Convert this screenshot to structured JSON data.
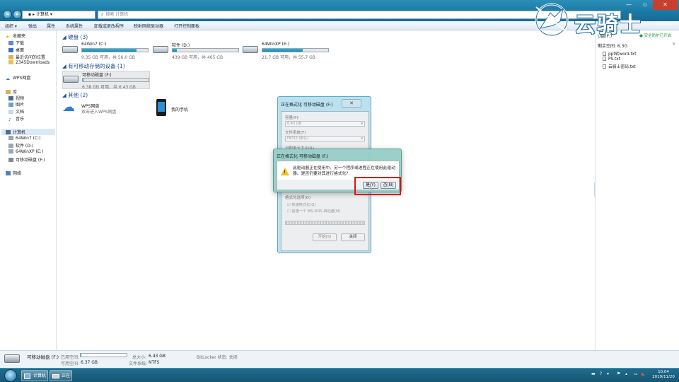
{
  "window": {
    "address_crumb": "计算机",
    "search_placeholder": "搜索 计算机",
    "minimize": "—",
    "maximize": "▫",
    "close": "✕"
  },
  "menubar": [
    "组织 ▾",
    "弹出",
    "属性",
    "系统属性",
    "卸载或更改程序",
    "映射网络驱动器",
    "打开控制面板"
  ],
  "sidebar": {
    "favorites": "收藏夹",
    "downloads": "下载",
    "desktop": "桌面",
    "recent": "最近访问的位置",
    "downloads2345": "2345Downloads",
    "wps": "WPS网盘",
    "libraries": "库",
    "videos": "视频",
    "pictures": "图片",
    "documents": "文档",
    "music": "音乐",
    "computer": "计算机",
    "drive_c": "64Win7 (C:)",
    "drive_d": "软件 (D:)",
    "drive_e": "64WinXP (E:)",
    "drive_f": "可移动磁盘 (F:)",
    "network": "网络"
  },
  "main": {
    "hdd_group": "硬盘 (3)",
    "removable_group": "有可移动存储的设备 (1)",
    "other_group": "其他 (2)",
    "drives": [
      {
        "name": "64Win7 (C:)",
        "free": "9.35 GB 可用，共 56.0 GB",
        "used_fraction": 0.83
      },
      {
        "name": "软件 (D:)",
        "free": "439 GB 可用，共 465 GB",
        "used_fraction": 0.06
      },
      {
        "name": "64WinXP (E:)",
        "free": "21.7 GB 可用，共 55.7 GB",
        "used_fraction": 0.61
      }
    ],
    "removable": {
      "name": "可移动磁盘 (F:)",
      "free": "6.38 GB 可用，共 6.43 GB",
      "used_fraction": 0.01
    },
    "others": [
      {
        "name": "WPS网盘",
        "sub": "双击进入WPS网盘"
      },
      {
        "name": "我的手机",
        "sub": ""
      }
    ]
  },
  "right_panel": {
    "drive": "U盘(F:)",
    "protect": "安全防护已开启",
    "space": "剩余空间: 6.3G",
    "close": "×",
    "files": [
      "ppt转word.txt",
      "PS.txt",
      "云骑士密码.txt"
    ]
  },
  "logo": {
    "text": "云骑士"
  },
  "format_dialog": {
    "title": "正在格式化 可移动磁盘 (F:)",
    "close": "✕",
    "capacity_label": "容量(P):",
    "capacity_value": "6.43 GB",
    "fs_label": "文件系统(F)",
    "fs_value": "FAT32 (默认)",
    "alloc_label": "分配单元大小(A)",
    "options_label": "格式化选项(O)",
    "quick_format": "☑ 快速格式化(Q)",
    "msdos": "☐ 创建一个 MS-DOS 启动盘(M)",
    "start": "开始(S)",
    "cancel": "关闭"
  },
  "warning_dialog": {
    "title": "正在格式化 可移动磁盘 (F:)",
    "close": "✕",
    "message": "此驱动器正在使用中。另一个程序或进程正在使用此驱动器。是否仍要对其进行格式化?",
    "yes": "是(Y)",
    "no": "否(N)"
  },
  "statusbar": {
    "drive_name": "可移动磁盘 (F:)",
    "used_label": "已用空间:",
    "free_label": "可用空间:",
    "free_value": "6.37 GB",
    "total_label": "总大小:",
    "total_value": "6.43 GB",
    "fs_label": "文件系统:",
    "fs_value": "NTFS",
    "bitlocker": "BitLocker 状态: 关闭",
    "used_fraction": 0.01
  },
  "taskbar": {
    "item1": "计算机",
    "item2": "正在",
    "time": "10:04",
    "date": "2019/11/20"
  },
  "colors": {
    "accent": "#1b77a3",
    "highlight": "#e01010",
    "bar_fill": "#1c87b3"
  }
}
